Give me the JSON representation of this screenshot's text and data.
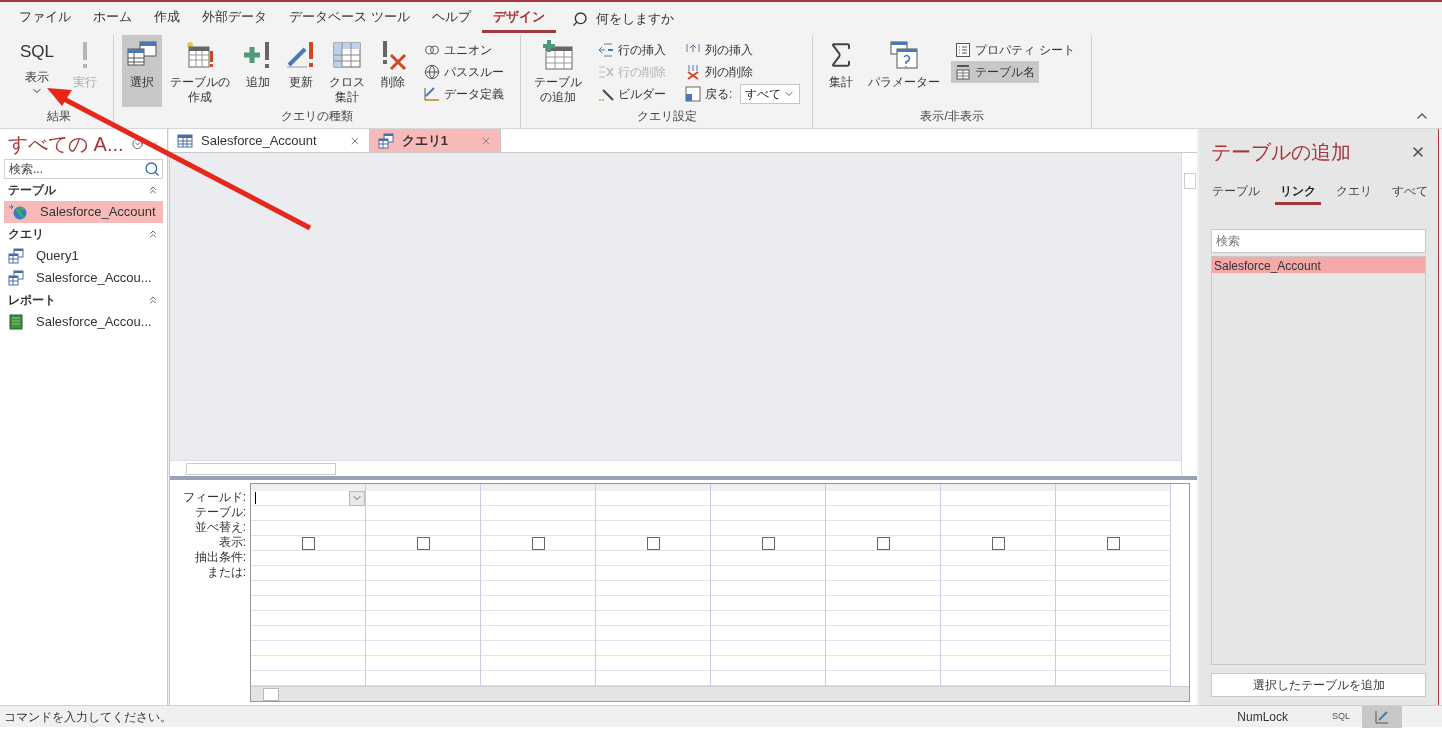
{
  "menu_tabs": [
    {
      "label": "ファイル",
      "selected": false
    },
    {
      "label": "ホーム",
      "selected": false
    },
    {
      "label": "作成",
      "selected": false
    },
    {
      "label": "外部データ",
      "selected": false
    },
    {
      "label": "データベース ツール",
      "selected": false
    },
    {
      "label": "ヘルプ",
      "selected": false
    },
    {
      "label": "デザイン",
      "selected": true
    }
  ],
  "tell_me": {
    "placeholder": "何をしますか"
  },
  "ribbon_groups": [
    {
      "title": "結果",
      "items": [
        {
          "kind": "sql",
          "big": "SQL",
          "label": "表示",
          "disabled": false,
          "selected": false
        },
        {
          "kind": "large",
          "label": "実行",
          "disabled": true,
          "selected": false
        }
      ]
    },
    {
      "title": "クエリの種類",
      "items": [
        {
          "kind": "large",
          "label": "選択",
          "disabled": false,
          "selected": true
        },
        {
          "kind": "large",
          "label": "テーブルの作成",
          "disabled": false,
          "selected": false
        },
        {
          "kind": "large",
          "label": "追加",
          "disabled": false,
          "selected": false
        },
        {
          "kind": "large",
          "label": "更新",
          "disabled": false,
          "selected": false
        },
        {
          "kind": "large",
          "label": "クロス集計",
          "disabled": false,
          "selected": false
        },
        {
          "kind": "large",
          "label": "削除",
          "disabled": false,
          "selected": false
        },
        {
          "kind": "column",
          "items": [
            {
              "label": "ユニオン",
              "disabled": false,
              "selected": false
            },
            {
              "label": "パススルー",
              "disabled": false,
              "selected": false
            },
            {
              "label": "データ定義",
              "disabled": false,
              "selected": false
            }
          ]
        }
      ]
    },
    {
      "title": "クエリ設定",
      "items": [
        {
          "kind": "large",
          "label": "テーブルの追加",
          "disabled": false,
          "selected": false
        },
        {
          "kind": "column",
          "items": [
            {
              "label": "行の挿入",
              "disabled": false,
              "selected": false
            },
            {
              "label": "行の削除",
              "disabled": true,
              "selected": false
            },
            {
              "label": "ビルダー",
              "disabled": false,
              "selected": false
            }
          ]
        },
        {
          "kind": "column",
          "items": [
            {
              "label": "列の挿入",
              "disabled": false,
              "selected": false
            },
            {
              "label": "列の削除",
              "disabled": false,
              "selected": false
            },
            {
              "label": "戻る:",
              "combo": "すべて",
              "disabled": false,
              "selected": false
            }
          ]
        }
      ]
    },
    {
      "title": "表示/非表示",
      "items": [
        {
          "kind": "large",
          "label": "集計",
          "disabled": false,
          "selected": false
        },
        {
          "kind": "large",
          "label": "パラメーター",
          "disabled": false,
          "selected": false
        },
        {
          "kind": "column",
          "items": [
            {
              "label": "プロパティ シート",
              "disabled": false,
              "selected": false
            },
            {
              "label": "テーブル名",
              "disabled": false,
              "selected": true
            }
          ]
        }
      ]
    }
  ],
  "nav_pane": {
    "title": "すべての A...",
    "search": {
      "placeholder": "検索..."
    },
    "groups": [
      {
        "title": "テーブル",
        "items": [
          {
            "label": "Salesforce_Account",
            "selected": true
          }
        ]
      },
      {
        "title": "クエリ",
        "items": [
          {
            "label": "Query1",
            "selected": false
          },
          {
            "label": "Salesforce_Accou...",
            "selected": false
          }
        ]
      },
      {
        "title": "レポート",
        "items": [
          {
            "label": "Salesforce_Accou...",
            "selected": false
          }
        ]
      }
    ]
  },
  "doc_tabs": [
    {
      "label": "Salesforce_Account",
      "selected": false
    },
    {
      "label": "クエリ1",
      "selected": true
    }
  ],
  "design_grid": {
    "row_labels": [
      "フィールド:",
      "テーブル:",
      "並べ替え:",
      "表示:",
      "抽出条件:",
      "または:"
    ],
    "columns": [
      {
        "shown": false
      },
      {
        "shown": false
      },
      {
        "shown": false
      },
      {
        "shown": false
      },
      {
        "shown": false
      },
      {
        "shown": false
      },
      {
        "shown": false
      },
      {
        "shown": false
      }
    ]
  },
  "add_table_pane": {
    "title": "テーブルの追加",
    "tabs": [
      {
        "label": "テーブル",
        "selected": false
      },
      {
        "label": "リンク",
        "selected": true
      },
      {
        "label": "クエリ",
        "selected": false
      },
      {
        "label": "すべて",
        "selected": false
      }
    ],
    "search": {
      "placeholder": "検索"
    },
    "list": [
      {
        "label": "Salesforce_Account",
        "selected": true
      }
    ],
    "add_button": "選択したテーブルを追加"
  },
  "status_bar": {
    "message": "コマンドを入力してください。",
    "indicators": [
      "NumLock"
    ],
    "views": [
      {
        "kind": "sql",
        "label": "SQL",
        "selected": false
      },
      {
        "kind": "design",
        "selected": true
      }
    ]
  }
}
